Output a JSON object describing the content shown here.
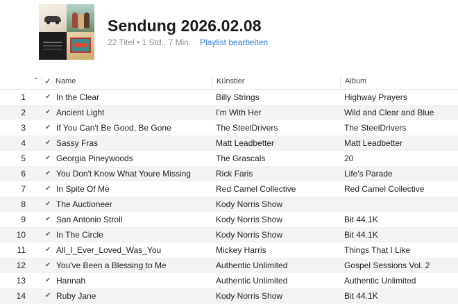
{
  "playlist": {
    "title": "Sendung 2026.02.08",
    "summary": "22 Titel • 1 Std., 7 Min.",
    "edit_label": "Playlist bearbeiten"
  },
  "columns": {
    "sort_icon": "⌃",
    "check": "✓",
    "name": "Name",
    "artist": "Künstler",
    "album": "Album"
  },
  "check_glyph": "✔",
  "tracks": [
    {
      "num": "1",
      "name": "In the Clear",
      "artist": "Billy Strings",
      "album": "Highway Prayers"
    },
    {
      "num": "2",
      "name": "Ancient Light",
      "artist": "I'm With Her",
      "album": "Wild and Clear and Blue"
    },
    {
      "num": "3",
      "name": "If You Can't Be Good, Be Gone",
      "artist": "The SteelDrivers",
      "album": "The SteelDrivers"
    },
    {
      "num": "4",
      "name": "Sassy Fras",
      "artist": "Matt Leadbetter",
      "album": "Matt Leadbetter"
    },
    {
      "num": "5",
      "name": "Georgia Pineywoods",
      "artist": "The Grascals",
      "album": "20"
    },
    {
      "num": "6",
      "name": "You Don't Know What Youre Missing",
      "artist": "Rick Faris",
      "album": "Life's Parade"
    },
    {
      "num": "7",
      "name": "In Spite Of Me",
      "artist": "Red Camel Collective",
      "album": "Red Camel Collective"
    },
    {
      "num": "8",
      "name": "The Auctioneer",
      "artist": "Kody Norris Show",
      "album": ""
    },
    {
      "num": "9",
      "name": "San Antonio Stroll",
      "artist": "Kody Norris Show",
      "album": "Bit 44.1K"
    },
    {
      "num": "10",
      "name": "In The Circle",
      "artist": "Kody Norris Show",
      "album": "Bit 44.1K"
    },
    {
      "num": "11",
      "name": "All_I_Ever_Loved_Was_You",
      "artist": "Mickey Harris",
      "album": "Things That I Like"
    },
    {
      "num": "12",
      "name": "You've Been a Blessing to Me",
      "artist": "Authentic Unlimited",
      "album": "Gospel Sessions Vol. 2"
    },
    {
      "num": "13",
      "name": "Hannah",
      "artist": "Authentic Unlimited",
      "album": "Authentic Unlimited"
    },
    {
      "num": "14",
      "name": "Ruby Jane",
      "artist": "Kody Norris Show",
      "album": "Bit 44.1K"
    }
  ]
}
